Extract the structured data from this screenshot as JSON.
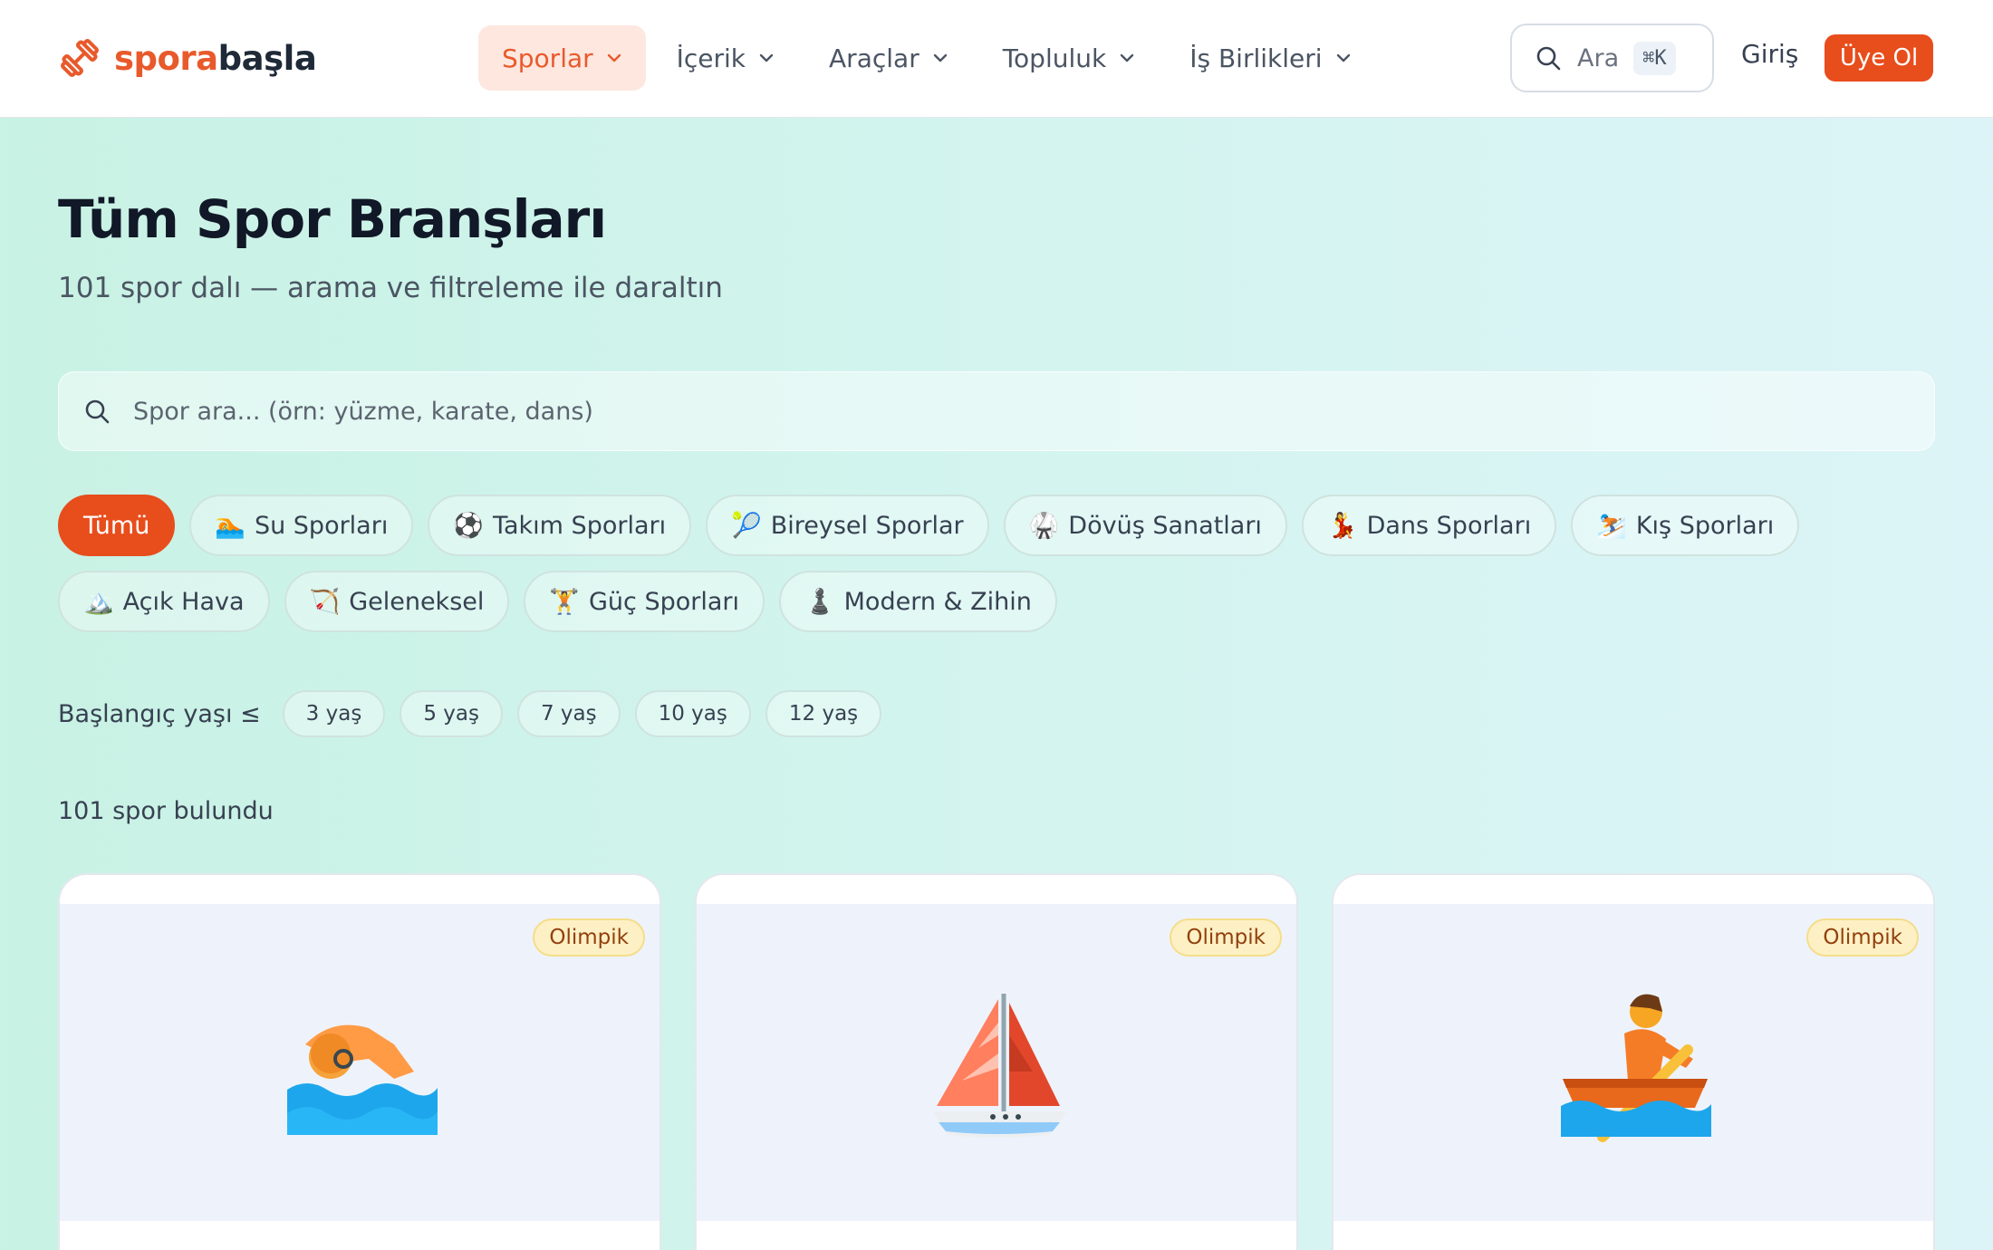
{
  "header": {
    "logo": {
      "part1": "spora",
      "part2": "başla"
    },
    "nav": [
      {
        "label": "Sporlar",
        "active": true
      },
      {
        "label": "İçerik",
        "active": false
      },
      {
        "label": "Araçlar",
        "active": false
      },
      {
        "label": "Topluluk",
        "active": false
      },
      {
        "label": "İş Birlikleri",
        "active": false
      }
    ],
    "search": {
      "label": "Ara",
      "shortcut": "⌘K"
    },
    "login": "Giriş",
    "signup": "Üye Ol"
  },
  "page": {
    "title": "Tüm Spor Branşları",
    "subtitle": "101 spor dalı — arama ve filtreleme ile daraltın"
  },
  "search": {
    "placeholder": "Spor ara... (örn: yüzme, karate, dans)",
    "value": ""
  },
  "categories": [
    {
      "emoji": "",
      "label": "Tümü",
      "active": true
    },
    {
      "emoji": "🏊",
      "label": "Su Sporları"
    },
    {
      "emoji": "⚽",
      "label": "Takım Sporları"
    },
    {
      "emoji": "🎾",
      "label": "Bireysel Sporlar"
    },
    {
      "emoji": "🥋",
      "label": "Dövüş Sanatları"
    },
    {
      "emoji": "💃",
      "label": "Dans Sporları"
    },
    {
      "emoji": "⛷️",
      "label": "Kış Sporları"
    },
    {
      "emoji": "🏔️",
      "label": "Açık Hava"
    },
    {
      "emoji": "🏹",
      "label": "Geleneksel"
    },
    {
      "emoji": "🏋️",
      "label": "Güç Sporları"
    },
    {
      "emoji": "♟️",
      "label": "Modern & Zihin"
    }
  ],
  "age_filter": {
    "label": "Başlangıç yaşı ≤",
    "options": [
      "3 yaş",
      "5 yaş",
      "7 yaş",
      "10 yaş",
      "12 yaş"
    ]
  },
  "results": {
    "count_text": "101 spor bulundu"
  },
  "cards": [
    {
      "badge": "Olimpik",
      "icon": "swimmer-icon"
    },
    {
      "badge": "Olimpik",
      "icon": "sailboat-icon"
    },
    {
      "badge": "Olimpik",
      "icon": "rowing-boat-icon"
    }
  ],
  "colors": {
    "accent": "#e84d1c",
    "accent_soft": "#fde7df",
    "badge_bg": "#fdf0c4"
  }
}
